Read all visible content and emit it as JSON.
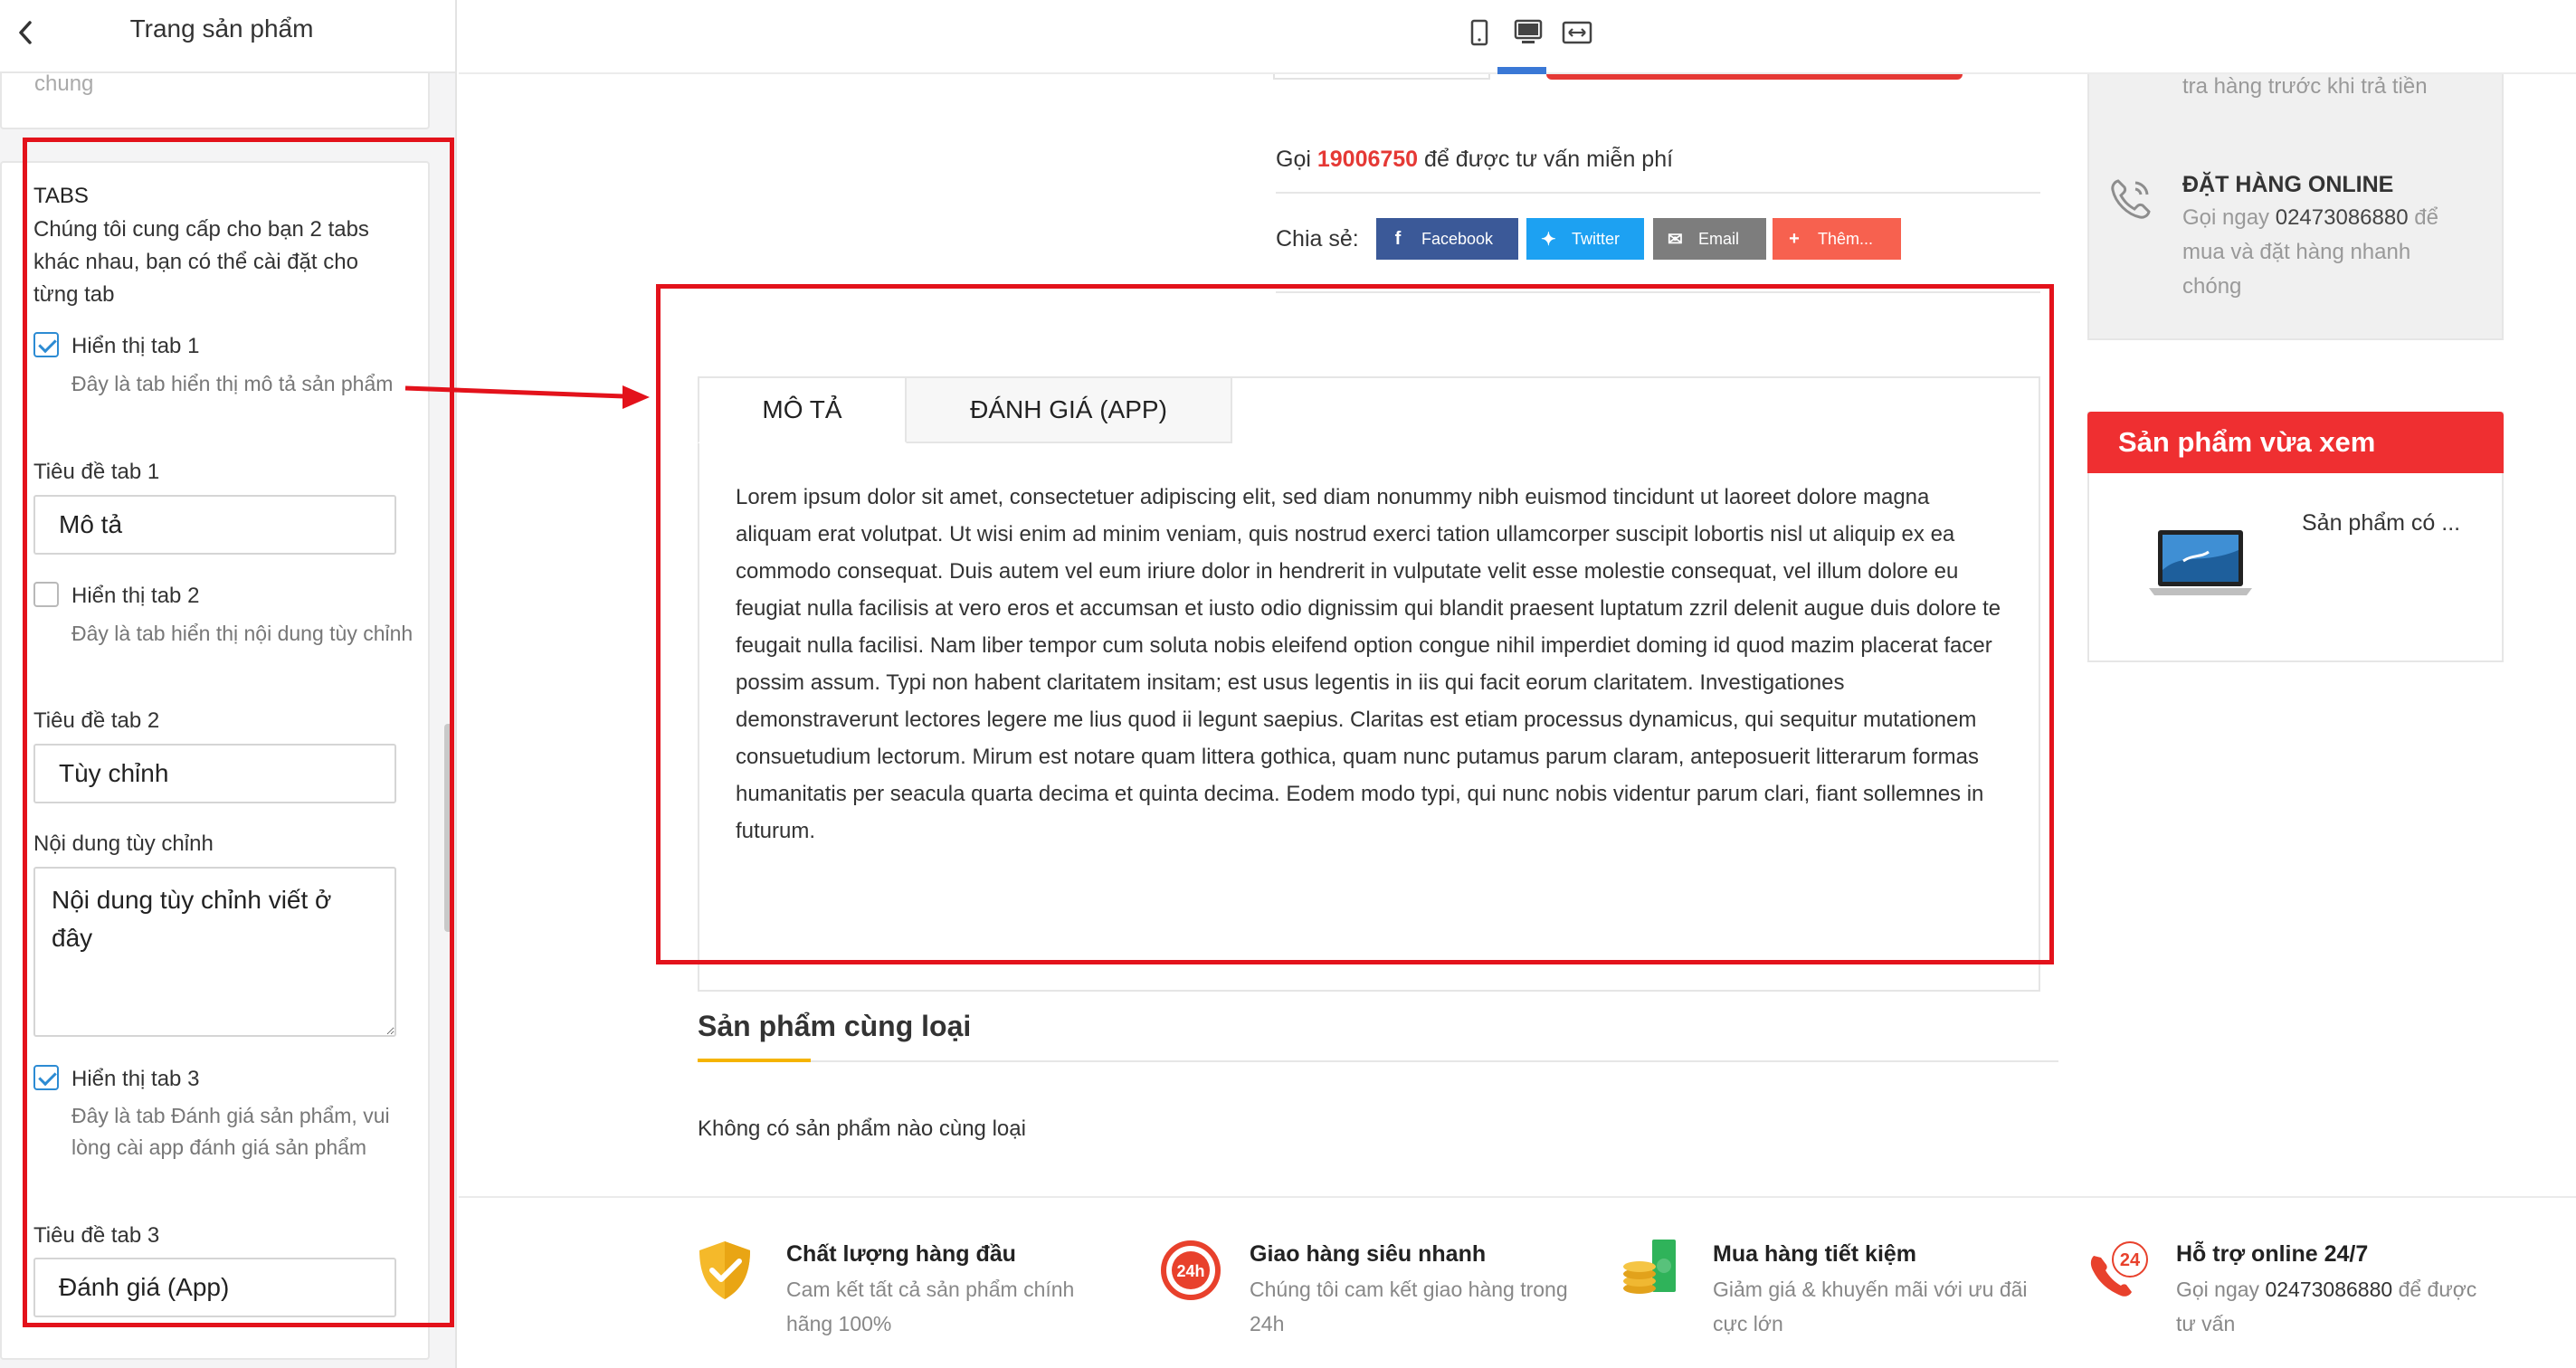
{
  "sidebar": {
    "title": "Trang sản phẩm",
    "prev_section_text": "chung",
    "tabs_heading": "TABS",
    "tabs_description": "Chúng tôi cung cấp cho bạn 2 tabs khác nhau, bạn có thể cài đặt cho từng tab",
    "tab1": {
      "checkbox_label": "Hiển thị tab 1",
      "checked": true,
      "help": "Đây là tab hiển thị mô tả sản phẩm",
      "title_label": "Tiêu đề tab 1",
      "title_value": "Mô tả"
    },
    "tab2": {
      "checkbox_label": "Hiển thị tab 2",
      "checked": false,
      "help": "Đây là tab hiển thị nội dung tùy chỉnh",
      "title_label": "Tiêu đề tab 2",
      "title_value": "Tùy chỉnh"
    },
    "custom_content": {
      "label": "Nội dung tùy chỉnh",
      "value": "Nội dung tùy chỉnh viết ở đây"
    },
    "tab3": {
      "checkbox_label": "Hiển thị tab 3",
      "checked": true,
      "help": "Đây là tab Đánh giá sản phẩm, vui lòng cài app đánh giá sản phẩm",
      "title_label": "Tiêu đề tab 3",
      "title_value": "Đánh giá (App)"
    }
  },
  "toolbar": {
    "devices": [
      "mobile-icon",
      "desktop-icon",
      "fullwidth-icon"
    ],
    "active_device": "desktop",
    "accent_color": "#3a78d6"
  },
  "preview": {
    "call": {
      "prefix": "Gọi",
      "phone": "19006750",
      "suffix": "để được tư vấn miễn phí"
    },
    "share": {
      "label": "Chia sẻ:",
      "buttons": [
        {
          "label": "Facebook",
          "icon": "facebook-icon",
          "color": "#3b5998"
        },
        {
          "label": "Twitter",
          "icon": "twitter-icon",
          "color": "#1da1f2"
        },
        {
          "label": "Email",
          "icon": "email-icon",
          "color": "#7d7d7d"
        },
        {
          "label": "Thêm...",
          "icon": "plus-icon",
          "color": "#f7614f"
        }
      ]
    },
    "tabs": [
      "MÔ TẢ",
      "ĐÁNH GIÁ (APP)"
    ],
    "active_tab": 0,
    "tab_content": "Lorem ipsum dolor sit amet, consectetuer adipiscing elit, sed diam nonummy nibh euismod tincidunt ut laoreet dolore magna aliquam erat volutpat. Ut wisi enim ad minim veniam, quis nostrud exerci tation ullamcorper suscipit lobortis nisl ut aliquip ex ea commodo consequat. Duis autem vel eum iriure dolor in hendrerit in vulputate velit esse molestie consequat, vel illum dolore eu feugiat nulla facilisis at vero eros et accumsan et iusto odio dignissim qui blandit praesent luptatum zzril delenit augue duis dolore te feugait nulla facilisi. Nam liber tempor cum soluta nobis eleifend option congue nihil imperdiet doming id quod mazim placerat facer possim assum. Typi non habent claritatem insitam; est usus legentis in iis qui facit eorum claritatem. Investigationes demonstraverunt lectores legere me lius quod ii legunt saepius. Claritas est etiam processus dynamicus, qui sequitur mutationem consuetudium lectorum. Mirum est notare quam littera gothica, quam nunc putamus parum claram, anteposuerit litterarum formas humanitatis per seacula quarta decima et quinta decima. Eodem modo typi, qui nunc nobis videntur parum clari, fiant sollemnes in futurum.",
    "related": {
      "title": "Sản phẩm cùng loại",
      "empty": "Không có sản phẩm nào cùng loại"
    },
    "support": {
      "top_text": "tra hàng trước khi trả tiền",
      "order_title": "ĐẶT HÀNG ONLINE",
      "order_desc_prefix": "Gọi ngay",
      "order_phone": "02473086880",
      "order_desc_suffix": "để mua và đặt hàng nhanh chóng"
    },
    "recently_viewed": {
      "title": "Sản phẩm vừa xem",
      "item_name": "Sản phẩm có ..."
    },
    "features": [
      {
        "icon": "shield-check-icon",
        "title": "Chất lượng hàng đầu",
        "desc": "Cam kết tất cả sản phẩm chính hãng 100%"
      },
      {
        "icon": "fast-delivery-24h-icon",
        "title": "Giao hàng siêu nhanh",
        "desc": "Chúng tôi cam kết giao hàng trong 24h"
      },
      {
        "icon": "money-coins-icon",
        "title": "Mua hàng tiết kiệm",
        "desc": "Giảm giá & khuyến mãi với ưu đãi cực lớn"
      },
      {
        "icon": "support-24-phone-icon",
        "title": "Hỗ trợ online 24/7",
        "desc_prefix": "Gọi ngay",
        "phone": "02473086880",
        "desc_suffix": "để được tư vấn"
      }
    ],
    "brand_red": "#ef2f31"
  }
}
